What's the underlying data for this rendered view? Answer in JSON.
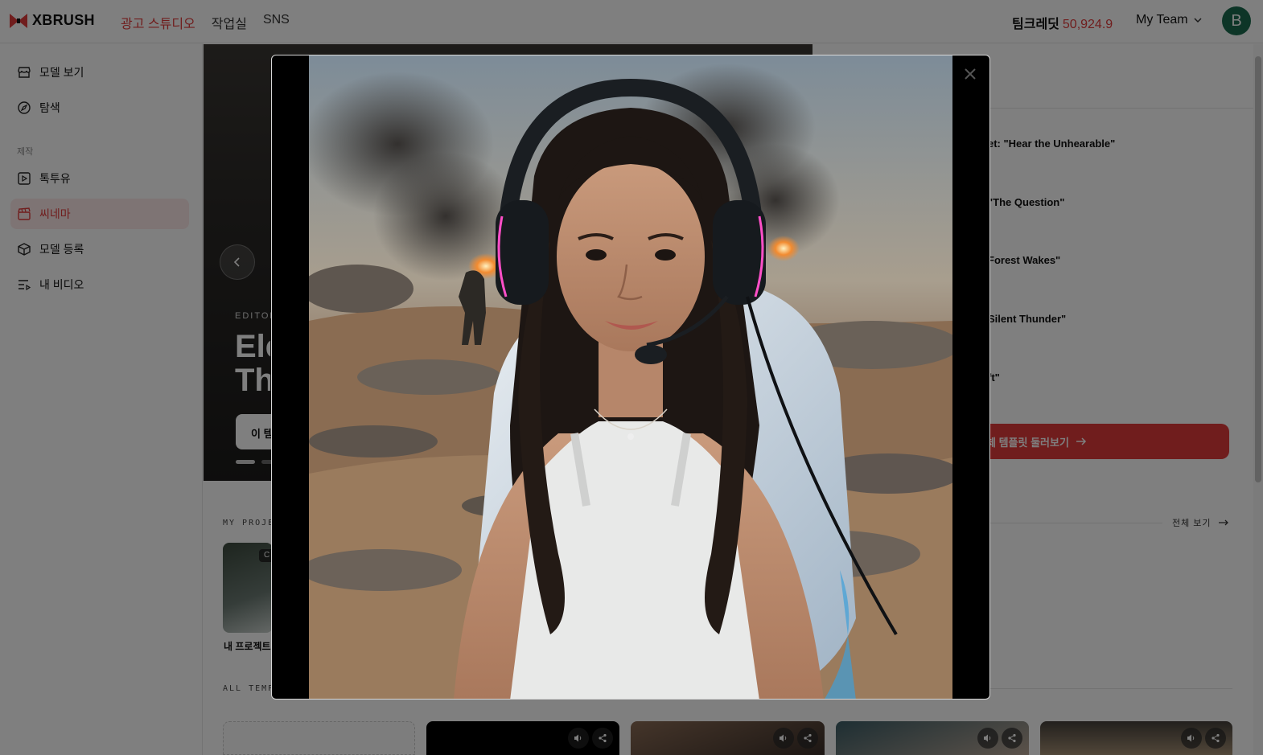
{
  "app": {
    "name": "XBRUSH"
  },
  "nav": {
    "studio": "광고 스튜디오",
    "workspace": "작업실",
    "sns": "SNS"
  },
  "credits": {
    "label": "팀크레딧",
    "amount": "50,924.9"
  },
  "team": {
    "name": "My Team"
  },
  "user": {
    "initial": "B"
  },
  "sidebar": {
    "models": "모델 보기",
    "explore": "탐색",
    "section_create": "제작",
    "talkyou": "톡투유",
    "cinema": "씨네마",
    "register_model": "모델 등록",
    "my_videos": "내 비디오"
  },
  "hero": {
    "kicker": "EDITOR",
    "title_line1": "Ele",
    "title_line2": "Th",
    "button": "이 템"
  },
  "templates_list": [
    "et: \"Hear the Unhearable\"",
    " \"The Question\"",
    " Forest Wakes\"",
    "Silent Thunder\"",
    "ft\""
  ],
  "browse_button": "체 템플릿 둘러보기",
  "my_projects": {
    "label": "MY PROJE",
    "view_all": "전체 보기",
    "badge": "C",
    "project_name": "내 프로젝트"
  },
  "all_templates": {
    "label": "ALL TEMP"
  },
  "colors": {
    "accent": "#e03a3a",
    "avatar": "#1a6b4f",
    "active_bg": "#fde8e8"
  },
  "icons": {
    "logo": "xbrush-bowtie-logo",
    "chevron": "chevron-down-icon",
    "store": "store-icon",
    "compass": "compass-icon",
    "play": "play-square-icon",
    "clapper": "clapperboard-icon",
    "box": "box-icon",
    "list": "list-video-icon",
    "arrow": "arrow-right-icon",
    "volume": "volume-icon",
    "share": "share-icon"
  },
  "modal": {
    "content": "video-player"
  }
}
